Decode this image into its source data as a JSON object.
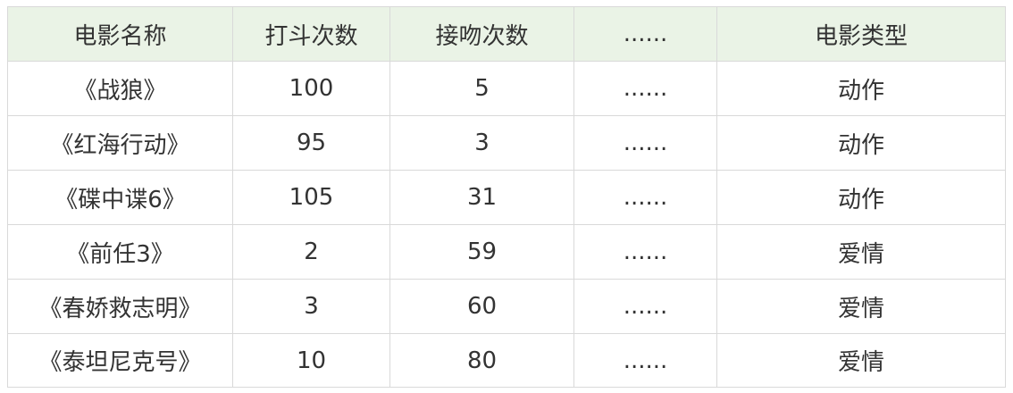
{
  "table": {
    "headers": [
      "电影名称",
      "打斗次数",
      "接吻次数",
      "......",
      "电影类型"
    ],
    "rows": [
      [
        "《战狼》",
        "100",
        "5",
        "......",
        "动作"
      ],
      [
        "《红海行动》",
        "95",
        "3",
        "......",
        "动作"
      ],
      [
        "《碟中谍6》",
        "105",
        "31",
        "......",
        "动作"
      ],
      [
        "《前任3》",
        "2",
        "59",
        "......",
        "爱情"
      ],
      [
        "《春娇救志明》",
        "3",
        "60",
        "......",
        "爱情"
      ],
      [
        "《泰坦尼克号》",
        "10",
        "80",
        "......",
        "爱情"
      ]
    ]
  },
  "colors": {
    "header_background": "#eaf3e6",
    "border": "#d9d9d9",
    "text": "#333333"
  }
}
